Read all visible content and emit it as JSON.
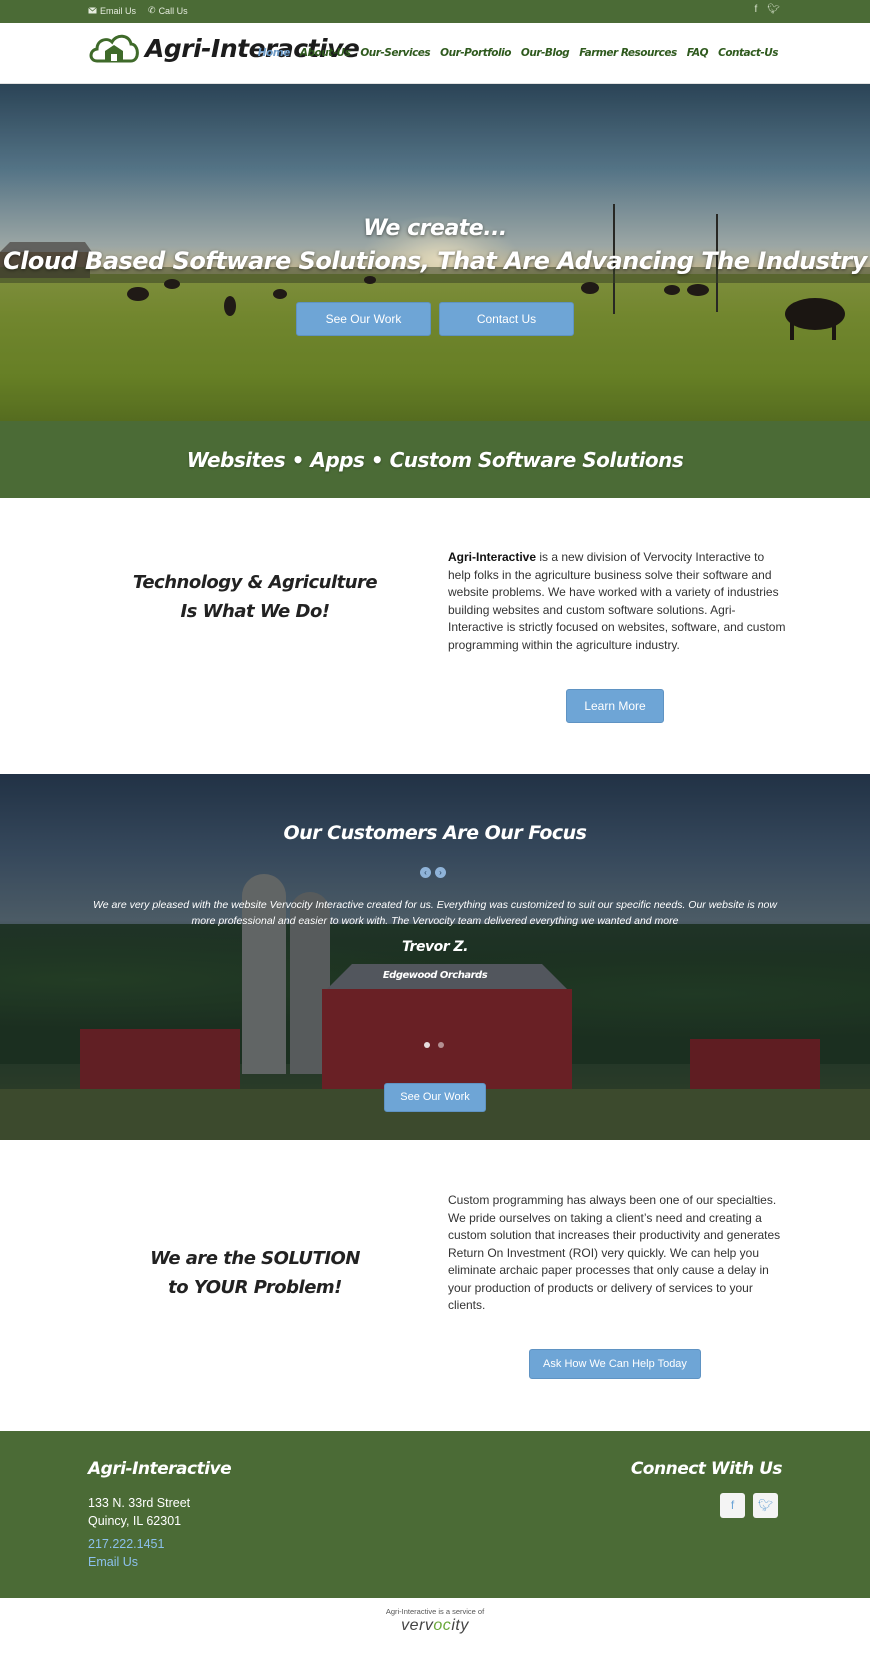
{
  "topbar": {
    "email_label": "Email Us",
    "call_label": "Call Us",
    "social": [
      "facebook-icon",
      "twitter-icon"
    ]
  },
  "header": {
    "logo_text": "Agri-Interactive",
    "nav": [
      "Home",
      "About-Us",
      "Our-Services",
      "Our-Portfolio",
      "Our-Blog",
      "Farmer Resources",
      "FAQ",
      "Contact-Us"
    ],
    "active_nav": "Home"
  },
  "hero": {
    "line1": "We create...",
    "line2": "Cloud Based Software Solutions, That Are Advancing The Industry",
    "button1": "See Our Work",
    "button2": "Contact Us"
  },
  "band": {
    "title": "Websites • Apps • Custom Software Solutions"
  },
  "about": {
    "heading_line1": "Technology & Agriculture",
    "heading_line2": "Is What We Do!",
    "text_bold": "Agri-Interactive",
    "text_rest": " is a new division of Vervocity Interactive to help folks in the agriculture business solve their software and website problems. We have worked with a variety of industries building websites and custom software solutions. Agri-Interactive is strictly focused on websites, software, and custom programming within the agriculture industry.",
    "button": "Learn More"
  },
  "testimonial": {
    "title": "Our Customers Are Our Focus",
    "quote": "We are very pleased with the website Vervocity Interactive created for us. Everything was customized to suit our specific needs. Our website is now more professional and easier to work with. The Vervocity team delivered everything we wanted and more",
    "name": "Trevor Z.",
    "company": "Edgewood Orchards",
    "button": "See Our Work"
  },
  "solution": {
    "heading_line1": "We are the SOLUTION",
    "heading_line2": "to YOUR Problem!",
    "text": "Custom programming has always been one of our specialties.  We pride ourselves on taking a client’s need and creating a custom solution that increases their productivity and generates Return On Investment (ROI) very quickly.  We can help you eliminate archaic paper processes that only cause a delay in your production of products or delivery of services to your clients.",
    "button": "Ask How We Can Help Today"
  },
  "footer": {
    "brand": "Agri-Interactive",
    "address_line1": "133 N. 33rd Street",
    "address_line2": "Quincy, IL 62301",
    "phone": "217.222.1451",
    "email_link": "Email Us",
    "connect_title": "Connect With Us"
  },
  "bottom": {
    "note": "Agri-Interactive is a service of",
    "logo_start": "verv",
    "logo_mid": "oc",
    "logo_end": "ity"
  },
  "colors": {
    "brand_green": "#4b6b36",
    "button_blue": "#6ea5d6",
    "link_blue": "#8cc0ec",
    "nav_green": "#2f5a1e",
    "nav_active": "#6e9cc8"
  }
}
